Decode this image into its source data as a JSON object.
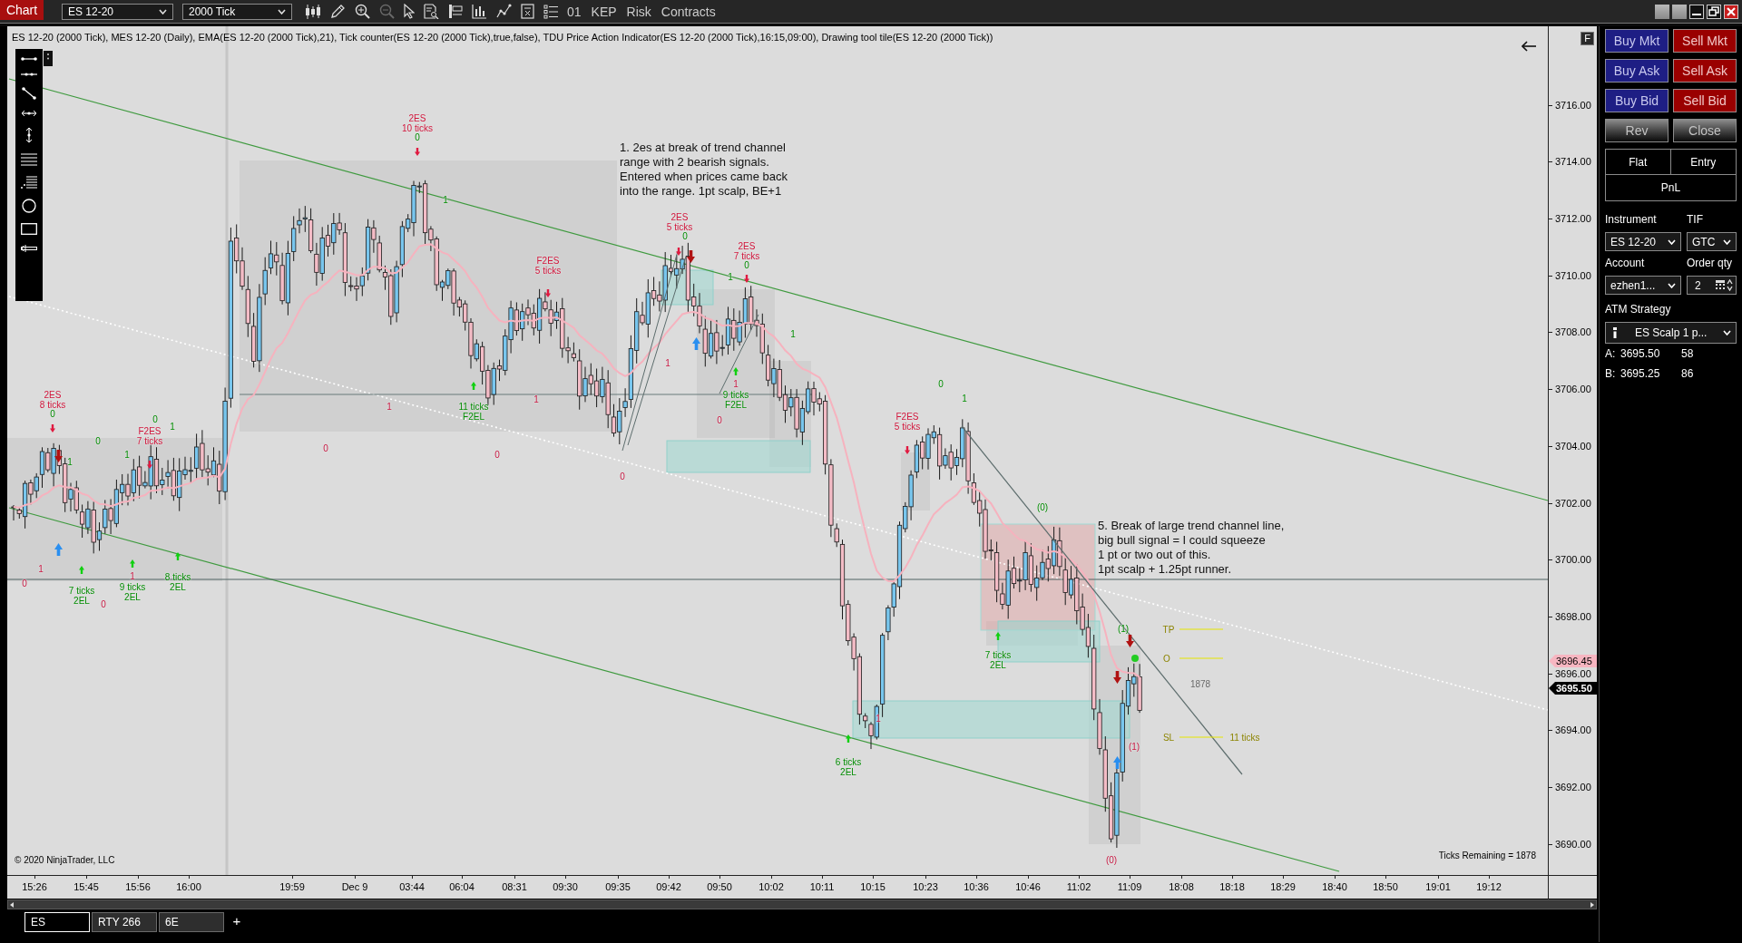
{
  "title_bar": {
    "app_label": "Chart",
    "instrument": "ES 12-20",
    "interval": "2000 Tick",
    "menu_items": [
      "01",
      "KEP",
      "Risk",
      "Contracts"
    ]
  },
  "chart": {
    "info_line": "ES 12-20 (2000 Tick), MES 12-20 (Daily), EMA(ES 12-20 (2000 Tick),21), Tick counter(ES 12-20 (2000 Tick),true,false), TDU Price Action Indicator(ES 12-20 (2000 Tick),16:15,09:00), Drawing tool tile(ES 12-20 (2000 Tick))",
    "notes": [
      {
        "lines": [
          "1. 2es at break of trend channel",
          "range with 2 bearish signals.",
          "Entered when prices came back",
          "into the range. 1pt scalp, BE+1"
        ]
      },
      {
        "lines": [
          "5. Break of large trend channel line,",
          "big bull signal = I could squeeze",
          "1 pt or two out of this.",
          "1pt scalp + 1.25pt runner."
        ]
      }
    ],
    "signals": [
      {
        "kind": "short",
        "lines": [
          "2ES",
          "10 ticks"
        ]
      },
      {
        "kind": "short",
        "lines": [
          "2ES",
          "5 ticks"
        ]
      },
      {
        "kind": "short",
        "lines": [
          "2ES",
          "7 ticks"
        ]
      },
      {
        "kind": "short",
        "lines": [
          "F2ES",
          "5 ticks"
        ]
      },
      {
        "kind": "long",
        "lines": [
          "9 ticks",
          "F2EL"
        ]
      },
      {
        "kind": "short",
        "lines": [
          "2ES",
          "8 ticks"
        ]
      },
      {
        "kind": "long",
        "lines": [
          "11 ticks",
          "F2EL"
        ]
      },
      {
        "kind": "short",
        "lines": [
          "F2ES",
          "5 ticks"
        ]
      },
      {
        "kind": "short",
        "lines": [
          "F2ES",
          "7 ticks"
        ]
      },
      {
        "kind": "long",
        "lines": [
          "8 ticks",
          "2EL"
        ]
      },
      {
        "kind": "long",
        "lines": [
          "9 ticks",
          "2EL"
        ]
      },
      {
        "kind": "long",
        "lines": [
          "7 ticks",
          "2EL"
        ]
      },
      {
        "kind": "long",
        "lines": [
          "7 ticks",
          "2EL"
        ]
      },
      {
        "kind": "long",
        "lines": [
          "6 ticks",
          "2EL"
        ]
      }
    ],
    "counts": [
      {
        "kind": "bull",
        "text": "0"
      },
      {
        "kind": "bull",
        "text": "1"
      },
      {
        "kind": "bull",
        "text": "0"
      },
      {
        "kind": "bull",
        "text": "0"
      },
      {
        "kind": "bull",
        "text": "1"
      },
      {
        "kind": "bull",
        "text": "1"
      },
      {
        "kind": "bear",
        "text": "1"
      },
      {
        "kind": "bull",
        "text": "0"
      },
      {
        "kind": "bear",
        "text": "1"
      },
      {
        "kind": "bull",
        "text": "1"
      },
      {
        "kind": "bear",
        "text": "1"
      },
      {
        "kind": "bear",
        "text": "1"
      },
      {
        "kind": "bull",
        "text": "0"
      },
      {
        "kind": "bull",
        "text": "0"
      },
      {
        "kind": "bear",
        "text": "0"
      },
      {
        "kind": "bull",
        "text": "1"
      },
      {
        "kind": "bull",
        "text": "0"
      },
      {
        "kind": "bear",
        "text": "0"
      },
      {
        "kind": "bull",
        "text": "1"
      },
      {
        "kind": "bear",
        "text": "0"
      },
      {
        "kind": "bull",
        "text": "1"
      },
      {
        "kind": "bear",
        "text": "0"
      },
      {
        "kind": "bull",
        "text": "(0)"
      },
      {
        "kind": "bear",
        "text": "1"
      },
      {
        "kind": "bear",
        "text": "1"
      },
      {
        "kind": "bear",
        "text": "0"
      },
      {
        "kind": "bear",
        "text": "0"
      },
      {
        "kind": "bull",
        "text": "(1)"
      },
      {
        "kind": "bear",
        "text": "1"
      },
      {
        "kind": "bear",
        "text": "(1)"
      },
      {
        "kind": "bear",
        "text": "(0)"
      }
    ],
    "trade_levels": [
      {
        "label": "TP"
      },
      {
        "label": "O"
      },
      {
        "label": "SL",
        "detail": "11 ticks"
      }
    ],
    "bar_count": "1878",
    "copyright": "© 2020 NinjaTrader, LLC",
    "ticks_remaining": "Ticks Remaining = 1878",
    "price_axis": {
      "button": "F",
      "labels": [
        "3716.00",
        "3714.00",
        "3712.00",
        "3710.00",
        "3708.00",
        "3706.00",
        "3704.00",
        "3702.00",
        "3700.00",
        "3698.00",
        "3696.00",
        "3694.00",
        "3692.00",
        "3690.00"
      ],
      "tags": [
        {
          "kind": "alert",
          "text": "3696.45"
        },
        {
          "kind": "last",
          "text": "3695.50"
        }
      ]
    },
    "time_axis": [
      "15:26",
      "15:45",
      "15:56",
      "16:00",
      "19:59",
      "Dec 9",
      "03:44",
      "06:04",
      "08:31",
      "09:30",
      "09:35",
      "09:42",
      "09:50",
      "10:02",
      "10:11",
      "10:15",
      "10:23",
      "10:36",
      "10:46",
      "11:02",
      "11:09",
      "18:08",
      "18:18",
      "18:29",
      "18:40",
      "18:50",
      "19:01",
      "19:12"
    ]
  },
  "tabs": [
    {
      "label": "ES",
      "selected": true
    },
    {
      "label": "RTY 266",
      "selected": false
    },
    {
      "label": "6E",
      "selected": false
    }
  ],
  "add_tab": "+",
  "chart_trader": {
    "order_buttons": [
      {
        "kind": "buy",
        "label": "Buy Mkt"
      },
      {
        "kind": "sell",
        "label": "Sell Mkt"
      },
      {
        "kind": "buy",
        "label": "Buy Ask"
      },
      {
        "kind": "sell",
        "label": "Sell Ask"
      },
      {
        "kind": "buy",
        "label": "Buy Bid"
      },
      {
        "kind": "sell",
        "label": "Sell Bid"
      },
      {
        "kind": "neutral",
        "label": "Rev"
      },
      {
        "kind": "neutral",
        "label": "Close"
      }
    ],
    "position": {
      "status": "Flat",
      "entry": "Entry",
      "pnl": "PnL"
    },
    "fields": [
      {
        "kind": "select",
        "label": "Instrument",
        "value": "ES 12-20"
      },
      {
        "kind": "select",
        "label": "TIF",
        "value": "GTC"
      },
      {
        "kind": "select",
        "label": "Account",
        "value": "ezhen1..."
      },
      {
        "kind": "spinner",
        "label": "Order qty",
        "value": "2"
      }
    ],
    "atm_strategy": {
      "label": "ATM Strategy",
      "value": "ES Scalp 1 p..."
    },
    "quotes": [
      {
        "side": "A:",
        "price": "3695.50",
        "size": "58"
      },
      {
        "side": "B:",
        "price": "3695.25",
        "size": "86"
      }
    ]
  }
}
